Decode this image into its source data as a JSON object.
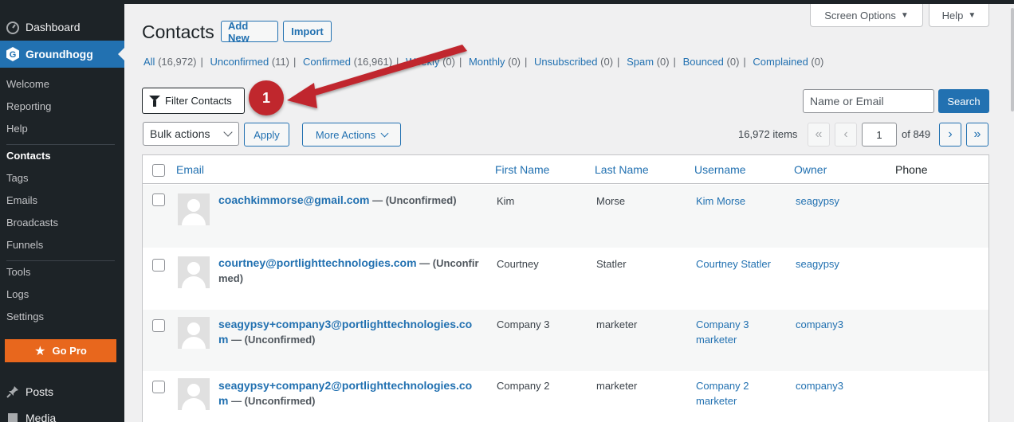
{
  "sidebar": {
    "dashboard": "Dashboard",
    "plugin": "Groundhogg",
    "subitems": [
      "Welcome",
      "Reporting",
      "Help",
      "Contacts",
      "Tags",
      "Emails",
      "Broadcasts",
      "Funnels",
      "Tools",
      "Logs",
      "Settings"
    ],
    "current_subitem": "Contacts",
    "gopro": "Go Pro",
    "posts": "Posts",
    "media": "Media",
    "colors": {
      "bg": "#1d2327",
      "active": "#2271b1",
      "gopro": "#e8671d"
    }
  },
  "header": {
    "title": "Contacts",
    "add_new": "Add New",
    "import": "Import",
    "screen_options": "Screen Options",
    "help": "Help"
  },
  "views": [
    {
      "label": "All",
      "count": "(16,972)"
    },
    {
      "label": "Unconfirmed",
      "count": "(11)"
    },
    {
      "label": "Confirmed",
      "count": "(16,961)"
    },
    {
      "label": "Weekly",
      "count": "(0)"
    },
    {
      "label": "Monthly",
      "count": "(0)"
    },
    {
      "label": "Unsubscribed",
      "count": "(0)"
    },
    {
      "label": "Spam",
      "count": "(0)"
    },
    {
      "label": "Bounced",
      "count": "(0)"
    },
    {
      "label": "Complained",
      "count": "(0)"
    }
  ],
  "filter": {
    "label": "Filter Contacts",
    "icon": "filter-icon"
  },
  "search": {
    "placeholder": "Name or Email",
    "button": "Search"
  },
  "bulk": {
    "selected": "Bulk actions",
    "apply": "Apply",
    "more": "More Actions"
  },
  "pagination": {
    "items": "16,972 items",
    "first": "«",
    "prev": "‹",
    "current": "1",
    "of": "of 849",
    "next": "›",
    "last": "»"
  },
  "table": {
    "columns": [
      "Email",
      "First Name",
      "Last Name",
      "Username",
      "Owner",
      "Phone"
    ],
    "rows": [
      {
        "email": "coachkimmorse@gmail.com",
        "status": " — (Unconfirmed)",
        "first": "Kim",
        "last": "Morse",
        "username": "Kim Morse",
        "owner": "seagypsy"
      },
      {
        "email": "courtney@portlighttechnologies.com",
        "status": " — (Unconfirmed)",
        "first": "Courtney",
        "last": "Statler",
        "username": "Courtney Statler",
        "owner": "seagypsy"
      },
      {
        "email": "seagypsy+company3@portlighttechnologies.com",
        "status": " — (Unconfirmed)",
        "first": "Company 3",
        "last": "marketer",
        "username": "Company 3 marketer",
        "owner": "company3"
      },
      {
        "email": "seagypsy+company2@portlighttechnologies.com",
        "status": " — (Unconfirmed)",
        "first": "Company 2",
        "last": "marketer",
        "username": "Company 2 marketer",
        "owner": "company3"
      }
    ]
  },
  "annotation": {
    "number": "1",
    "color": "#c0272d"
  }
}
